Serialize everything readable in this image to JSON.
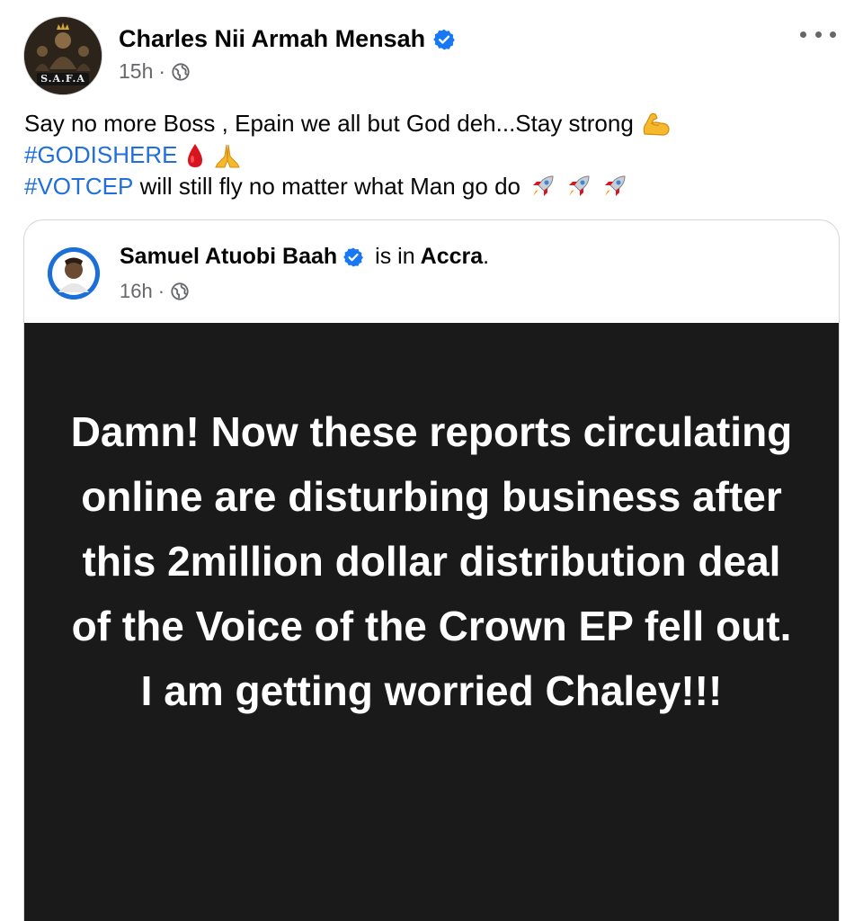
{
  "post": {
    "author": "Charles Nii Armah Mensah",
    "author_avatar_text": "S.A.F.A",
    "time": "15h",
    "dot": "·",
    "text_line1": "Say no more Boss , Epain we all but God deh...Stay strong",
    "hashtag1": "#GODISHERE",
    "hashtag2": "#VOTCEP",
    "text_line3": " will still fly no matter what Man go do"
  },
  "shared": {
    "author": "Samuel Atuobi Baah",
    "is_in": "is in",
    "location": "Accra",
    "period": ".",
    "time": "16h",
    "dot": "·",
    "content": "Damn! Now these reports circulating online are disturbing business after this 2million dollar distribution deal of the Voice of the Crown EP fell out. I am getting worried Chaley!!!",
    "background": "#1a1a1a"
  },
  "colors": {
    "hashtag": "#216fdb",
    "verified": "#1877f2",
    "meta": "#65676b"
  },
  "icons": [
    "verified-badge-icon",
    "globe-icon",
    "more-options-icon",
    "flexed-biceps-emoji",
    "drop-of-blood-emoji",
    "folded-hands-emoji",
    "rocket-emoji"
  ]
}
